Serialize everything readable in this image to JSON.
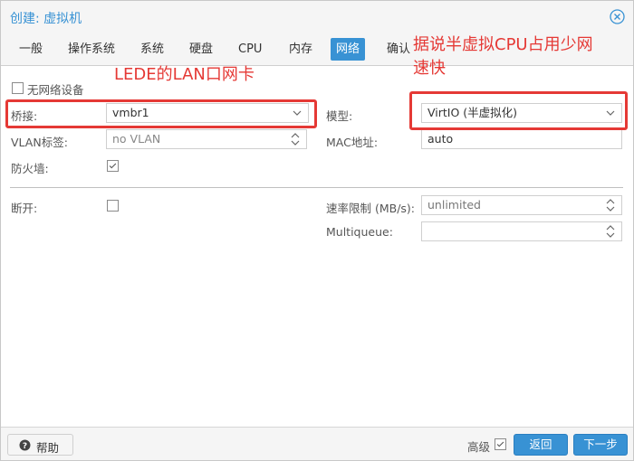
{
  "window": {
    "title": "创建: 虚拟机"
  },
  "tabs": [
    {
      "label": "一般"
    },
    {
      "label": "操作系统"
    },
    {
      "label": "系统"
    },
    {
      "label": "硬盘"
    },
    {
      "label": "CPU"
    },
    {
      "label": "内存"
    },
    {
      "label": "网络",
      "active": true
    },
    {
      "label": "确认"
    }
  ],
  "form": {
    "no_network_label": "无网络设备",
    "no_network_checked": false,
    "bridge_label": "桥接:",
    "bridge_value": "vmbr1",
    "vlan_label": "VLAN标签:",
    "vlan_value": "no VLAN",
    "firewall_label": "防火墙:",
    "firewall_checked": true,
    "model_label": "模型:",
    "model_value": "VirtIO (半虚拟化)",
    "mac_label": "MAC地址:",
    "mac_value": "auto",
    "disconnect_label": "断开:",
    "disconnect_checked": false,
    "rate_label": "速率限制 (MB/s):",
    "rate_value": "unlimited",
    "multiqueue_label": "Multiqueue:",
    "multiqueue_value": ""
  },
  "annotations": {
    "left_note": "LEDE的LAN口网卡",
    "right_note_line1": "据说半虚拟CPU占用少网",
    "right_note_line2": "速快",
    "color": "#e53935"
  },
  "footer": {
    "help_label": "帮助",
    "advanced_label": "高级",
    "advanced_checked": true,
    "back_label": "返回",
    "next_label": "下一步"
  },
  "colors": {
    "accent": "#3892d4",
    "annotation": "#e53935"
  }
}
